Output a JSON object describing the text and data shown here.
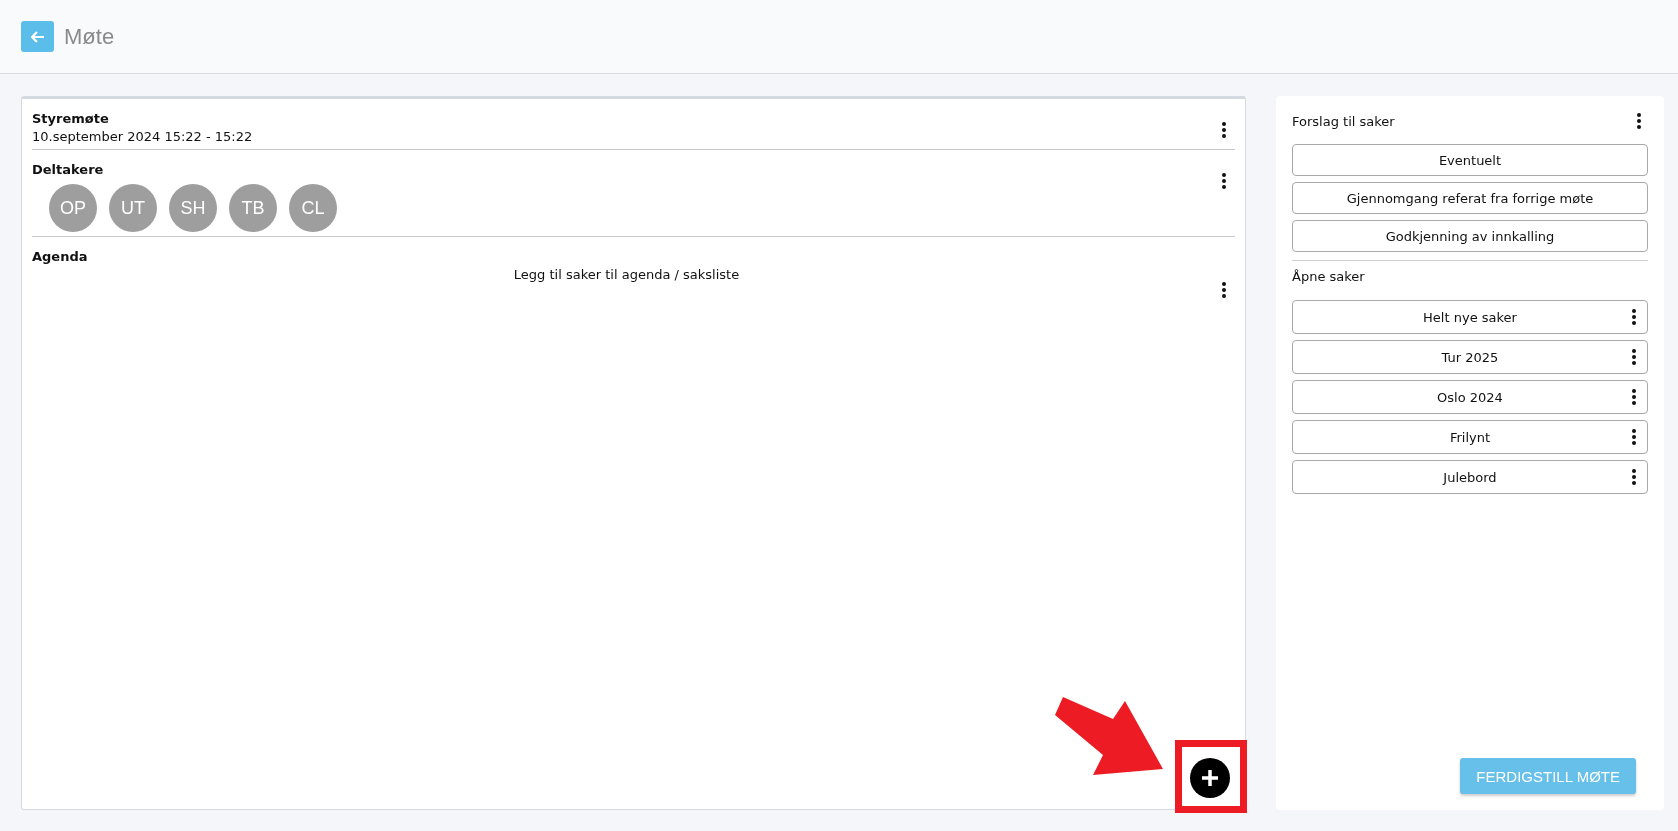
{
  "header": {
    "title": "Møte"
  },
  "meeting": {
    "title": "Styremøte",
    "datetime": "10.september 2024 15:22 - 15:22"
  },
  "participants": {
    "heading": "Deltakere",
    "avatars": [
      "OP",
      "UT",
      "SH",
      "TB",
      "CL"
    ]
  },
  "agenda": {
    "heading": "Agenda",
    "empty_hint": "Legg til saker til agenda / saksliste"
  },
  "suggestions": {
    "heading": "Forslag til saker",
    "items": [
      "Eventuelt",
      "Gjennomgang referat fra forrige møte",
      "Godkjenning av innkalling"
    ]
  },
  "open_items": {
    "heading": "Åpne saker",
    "items": [
      "Helt nye saker",
      "Tur 2025",
      "Oslo 2024",
      "Frilynt",
      "Julebord"
    ]
  },
  "complete_button": "FERDIGSTILL MØTE"
}
